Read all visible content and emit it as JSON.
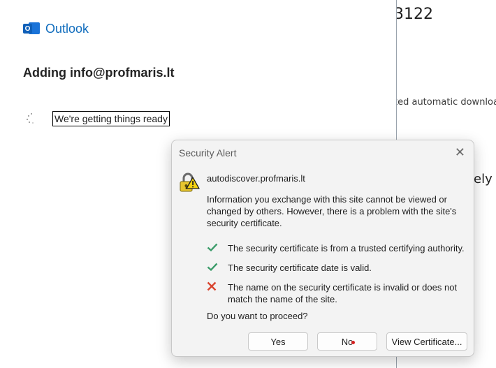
{
  "background_window": {
    "number_fragment": "3122",
    "download_fragment": "ted automatic download",
    "trailing_fragment": "ely a"
  },
  "outlook": {
    "app_name": "Outlook",
    "heading": "Adding info@profmaris.lt",
    "status": "We're getting things ready"
  },
  "dialog": {
    "title": "Security Alert",
    "host": "autodiscover.profmaris.lt",
    "info": "Information you exchange with this site cannot be viewed or changed by others. However, there is a problem with the site's security certificate.",
    "checks": [
      {
        "status": "ok",
        "text": "The security certificate is from a trusted certifying authority."
      },
      {
        "status": "ok",
        "text": "The security certificate date is valid."
      },
      {
        "status": "error",
        "text": "The name on the security certificate is invalid or does not match the name of the site."
      }
    ],
    "question": "Do you want to proceed?",
    "buttons": {
      "yes": "Yes",
      "no": "No",
      "view": "View Certificate..."
    }
  },
  "colors": {
    "ok": "#3c9c6a",
    "error": "#d9452f",
    "brand": "#0f6cbd"
  }
}
